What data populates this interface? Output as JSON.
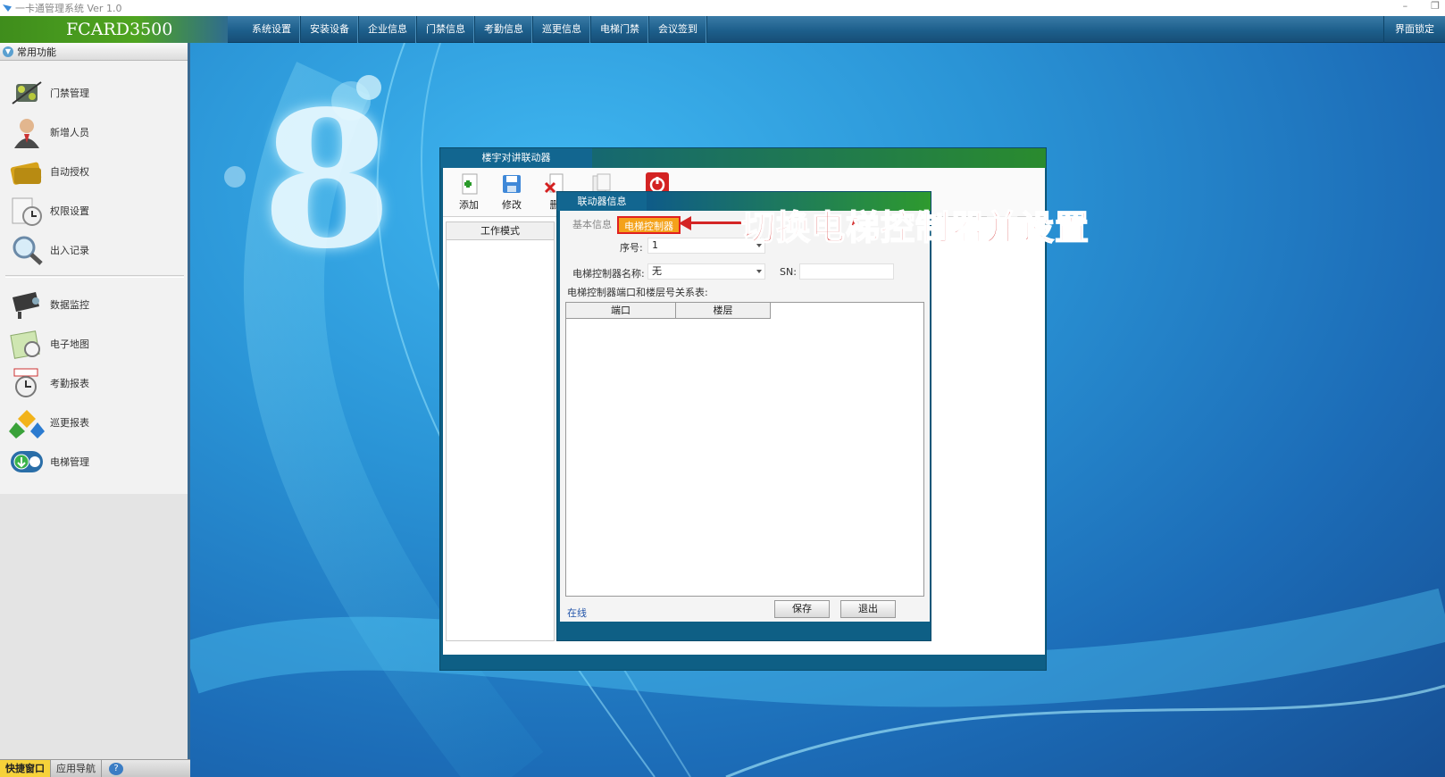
{
  "window": {
    "title": "一卡通管理系统  Ver 1.0",
    "minimize": "–",
    "restore": "❐"
  },
  "brand": "FCARD3500",
  "menu": [
    "系统设置",
    "安装设备",
    "企业信息",
    "门禁信息",
    "考勤信息",
    "巡更信息",
    "电梯门禁",
    "会议签到"
  ],
  "lock_label": "界面锁定",
  "sidebar": {
    "header": "常用功能",
    "items": [
      {
        "label": "门禁管理",
        "icon": "door-controller-icon"
      },
      {
        "label": "新增人员",
        "icon": "person-icon"
      },
      {
        "label": "自动授权",
        "icon": "card-icon"
      },
      {
        "label": "权限设置",
        "icon": "permission-clock-icon"
      },
      {
        "label": "出入记录",
        "icon": "magnifier-icon"
      },
      {
        "label": "数据监控",
        "icon": "camera-icon"
      },
      {
        "label": "电子地图",
        "icon": "map-icon"
      },
      {
        "label": "考勤报表",
        "icon": "stopwatch-icon"
      },
      {
        "label": "巡更报表",
        "icon": "patrol-icon"
      },
      {
        "label": "电梯管理",
        "icon": "elevator-icon"
      }
    ]
  },
  "bottom_tabs": [
    "快捷窗口",
    "应用导航",
    "?"
  ],
  "desktop_logo": "8",
  "outer_window": {
    "title": "楼宇对讲联动器",
    "toolbar": [
      {
        "label": "添加",
        "icon": "add-icon"
      },
      {
        "label": "修改",
        "icon": "save-icon"
      },
      {
        "label": "删",
        "icon": "delete-icon"
      },
      {
        "label": "",
        "icon": "copy-icon"
      },
      {
        "label": "",
        "icon": "power-icon"
      }
    ],
    "side_header": "工作模式"
  },
  "inner_dialog": {
    "title": "联动器信息",
    "tabs": [
      "基本信息",
      "电梯控制器"
    ],
    "serial_label": "序号:",
    "serial_value": "1",
    "controller_label": "电梯控制器名称:",
    "controller_value": "无",
    "sn_label": "SN:",
    "sn_value": "",
    "relation_label": "电梯控制器端口和楼层号关系表:",
    "columns": [
      "端口",
      "楼层"
    ],
    "status": "在线",
    "save": "保存",
    "exit": "退出"
  },
  "annotation": "切换电梯控制器并设置",
  "colors": {
    "accent_green": "#4fa520",
    "tab_highlight": "#f4a21a",
    "annotation_red": "#d32a2a"
  }
}
